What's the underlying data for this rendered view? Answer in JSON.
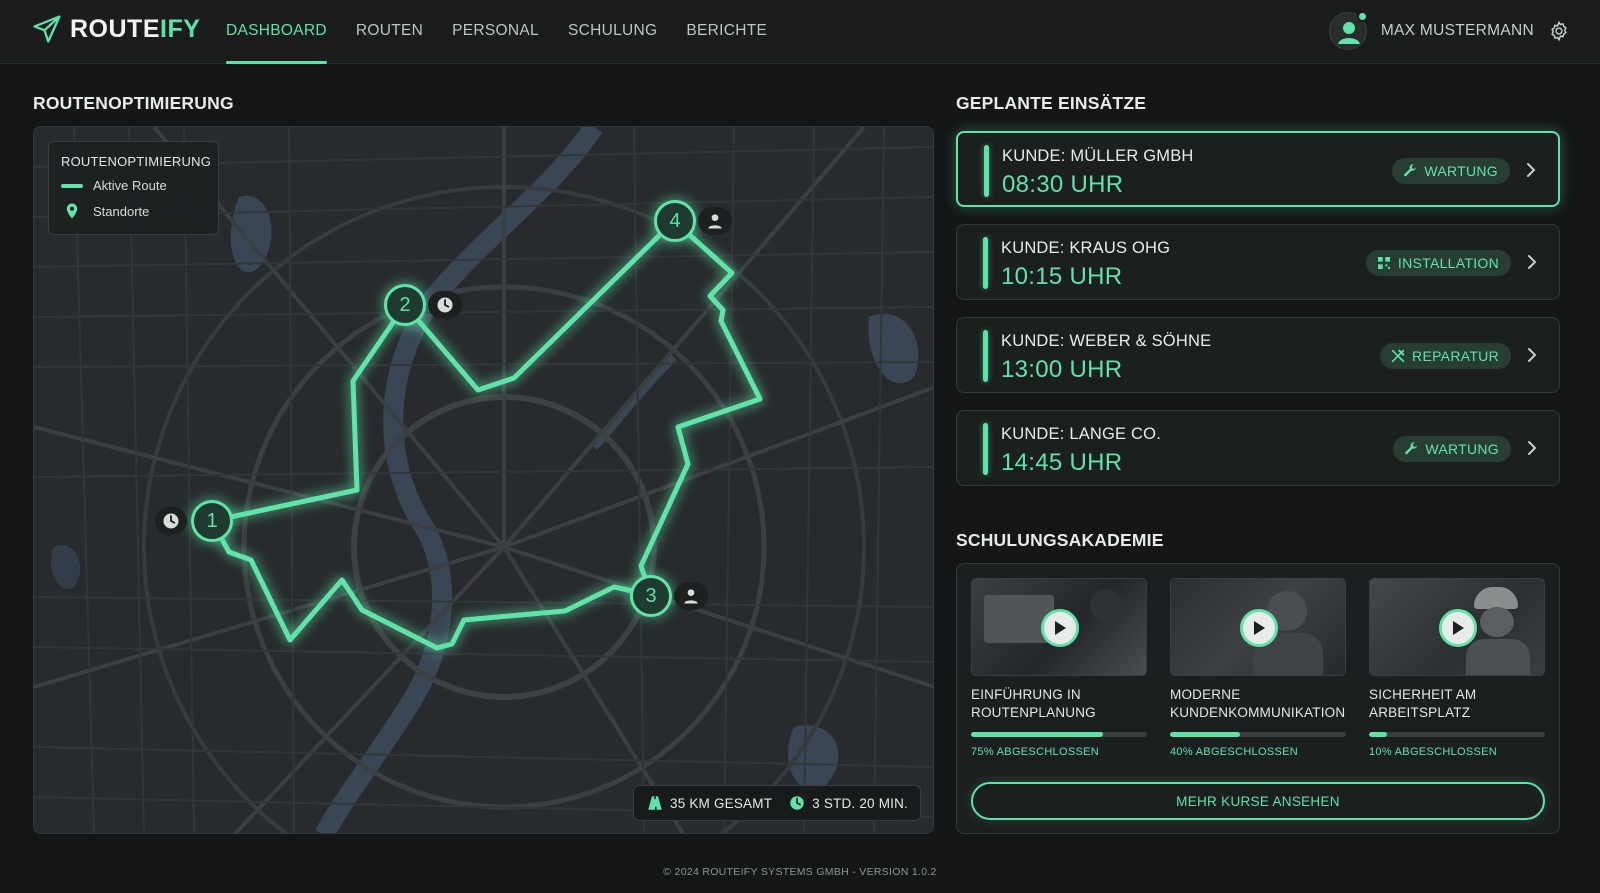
{
  "app": {
    "logo_main": "ROUTE",
    "logo_accent": "IFY"
  },
  "nav": {
    "items": [
      {
        "label": "DASHBOARD",
        "active": true
      },
      {
        "label": "ROUTEN",
        "active": false
      },
      {
        "label": "PERSONAL",
        "active": false
      },
      {
        "label": "SCHULUNG",
        "active": false
      },
      {
        "label": "BERICHTE",
        "active": false
      }
    ]
  },
  "user": {
    "name": "MAX MUSTERMANN",
    "avatar_icon": "user-avatar-icon",
    "settings_icon": "gear-icon"
  },
  "route": {
    "section_title": "ROUTENOPTIMIERUNG",
    "legend": {
      "title": "ROUTENOPTIMIERUNG",
      "active_route": "Aktive Route",
      "locations": "Standorte"
    },
    "stops": [
      {
        "number": "1",
        "icon": "clock-icon"
      },
      {
        "number": "2",
        "icon": "clock-icon"
      },
      {
        "number": "3",
        "icon": "person-icon"
      },
      {
        "number": "4",
        "icon": "person-icon"
      }
    ],
    "stats": {
      "distance": "35 KM GESAMT",
      "duration": "3 STD. 20 MIN."
    }
  },
  "appointments": {
    "section_title": "GEPLANTE EINSÄTZE",
    "items": [
      {
        "customer": "KUNDE: MÜLLER GMBH",
        "time": "08:30 UHR",
        "type": "WARTUNG",
        "icon": "wrench-icon",
        "active": true
      },
      {
        "customer": "KUNDE: KRAUS OHG",
        "time": "10:15 UHR",
        "type": "INSTALLATION",
        "icon": "grid-icon",
        "active": false
      },
      {
        "customer": "KUNDE: WEBER & SÖHNE",
        "time": "13:00 UHR",
        "type": "REPARATUR",
        "icon": "tools-icon",
        "active": false
      },
      {
        "customer": "KUNDE: LANGE CO.",
        "time": "14:45 UHR",
        "type": "WARTUNG",
        "icon": "wrench-icon",
        "active": false
      }
    ]
  },
  "academy": {
    "section_title": "SCHULUNGSAKADEMIE",
    "courses": [
      {
        "title_line1": "EINFÜHRUNG IN",
        "title_line2": "ROUTENPLANUNG",
        "progress": 0.75,
        "progress_label": "75% ABGESCHLOSSEN"
      },
      {
        "title_line1": "MODERNE",
        "title_line2": "KUNDENKOMMUNIKATION",
        "progress": 0.4,
        "progress_label": "40% ABGESCHLOSSEN"
      },
      {
        "title_line1": "SICHERHEIT AM",
        "title_line2": "ARBEITSPLATZ",
        "progress": 0.1,
        "progress_label": "10% ABGESCHLOSSEN"
      }
    ],
    "more_button": "MEHR KURSE ANSEHEN"
  },
  "footer": {
    "text": "© 2024 ROUTEIFY SYSTEMS GMBH - VERSION 1.0.2"
  },
  "colors": {
    "accent": "#5fe3a8",
    "background": "#141617",
    "panel": "#1c1f20"
  }
}
